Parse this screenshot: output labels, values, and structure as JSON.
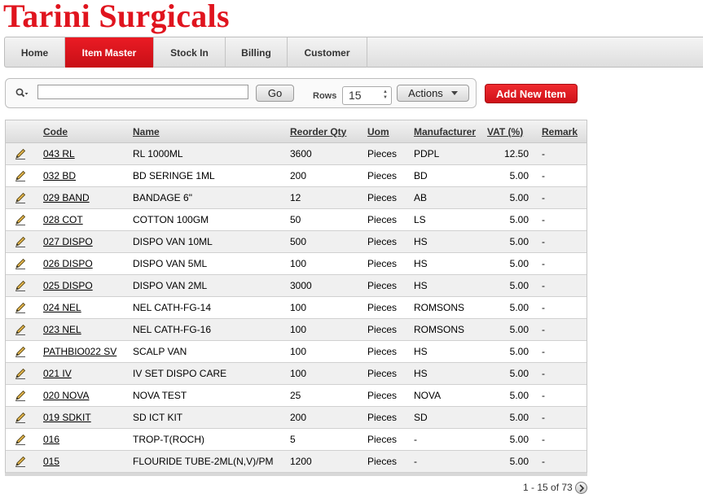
{
  "app": {
    "title": "Tarini Surgicals"
  },
  "tabs": [
    {
      "label": "Home"
    },
    {
      "label": "Item Master"
    },
    {
      "label": "Stock In"
    },
    {
      "label": "Billing"
    },
    {
      "label": "Customer"
    }
  ],
  "active_tab": "Item Master",
  "search": {
    "value": "",
    "go_label": "Go",
    "rows_label": "Rows",
    "rows_value": "15",
    "actions_label": "Actions",
    "add_label": "Add New Item"
  },
  "table": {
    "columns": [
      "Code",
      "Name",
      "Reorder Qty",
      "Uom",
      "Manufacturer",
      "VAT (%)",
      "Remark"
    ],
    "rows": [
      {
        "code": "043 RL",
        "name": "RL 1000ML",
        "reorder": "3600",
        "uom": "Pieces",
        "mfr": "PDPL",
        "vat": "12.50",
        "remark": "-"
      },
      {
        "code": "032 BD",
        "name": "BD SERINGE 1ML",
        "reorder": "200",
        "uom": "Pieces",
        "mfr": "BD",
        "vat": "5.00",
        "remark": "-"
      },
      {
        "code": "029 BAND",
        "name": "BANDAGE 6\"",
        "reorder": "12",
        "uom": "Pieces",
        "mfr": "AB",
        "vat": "5.00",
        "remark": "-"
      },
      {
        "code": "028 COT",
        "name": "COTTON 100GM",
        "reorder": "50",
        "uom": "Pieces",
        "mfr": "LS",
        "vat": "5.00",
        "remark": "-"
      },
      {
        "code": "027 DISPO",
        "name": "DISPO VAN 10ML",
        "reorder": "500",
        "uom": "Pieces",
        "mfr": "HS",
        "vat": "5.00",
        "remark": "-"
      },
      {
        "code": "026 DISPO",
        "name": "DISPO VAN 5ML",
        "reorder": "100",
        "uom": "Pieces",
        "mfr": "HS",
        "vat": "5.00",
        "remark": "-"
      },
      {
        "code": "025 DISPO",
        "name": "DISPO VAN 2ML",
        "reorder": "3000",
        "uom": "Pieces",
        "mfr": "HS",
        "vat": "5.00",
        "remark": "-"
      },
      {
        "code": "024 NEL",
        "name": "NEL CATH-FG-14",
        "reorder": "100",
        "uom": "Pieces",
        "mfr": "ROMSONS",
        "vat": "5.00",
        "remark": "-"
      },
      {
        "code": "023 NEL",
        "name": "NEL CATH-FG-16",
        "reorder": "100",
        "uom": "Pieces",
        "mfr": "ROMSONS",
        "vat": "5.00",
        "remark": "-"
      },
      {
        "code": "PATHBIO022 SV",
        "name": "SCALP VAN",
        "reorder": "100",
        "uom": "Pieces",
        "mfr": "HS",
        "vat": "5.00",
        "remark": "-"
      },
      {
        "code": "021 IV",
        "name": "IV SET DISPO CARE",
        "reorder": "100",
        "uom": "Pieces",
        "mfr": "HS",
        "vat": "5.00",
        "remark": "-"
      },
      {
        "code": "020 NOVA",
        "name": "NOVA TEST",
        "reorder": "25",
        "uom": "Pieces",
        "mfr": "NOVA",
        "vat": "5.00",
        "remark": "-"
      },
      {
        "code": "019 SDKIT",
        "name": "SD ICT KIT",
        "reorder": "200",
        "uom": "Pieces",
        "mfr": "SD",
        "vat": "5.00",
        "remark": "-"
      },
      {
        "code": "016",
        "name": "TROP-T(ROCH)",
        "reorder": "5",
        "uom": "Pieces",
        "mfr": "-",
        "vat": "5.00",
        "remark": "-"
      },
      {
        "code": "015",
        "name": "FLOURIDE TUBE-2ML(N,V)/PM",
        "reorder": "1200",
        "uom": "Pieces",
        "mfr": "-",
        "vat": "5.00",
        "remark": "-"
      }
    ]
  },
  "pagination": {
    "text": "1 - 15 of 73"
  },
  "colors": {
    "brand": "#e0141e",
    "active_tab": "#d9141c",
    "add_button": "#e01b22"
  },
  "icons": {
    "search": "search-icon",
    "edit": "edit-pencil-icon",
    "next": "next-page-icon",
    "caret": "chevron-down-icon"
  }
}
